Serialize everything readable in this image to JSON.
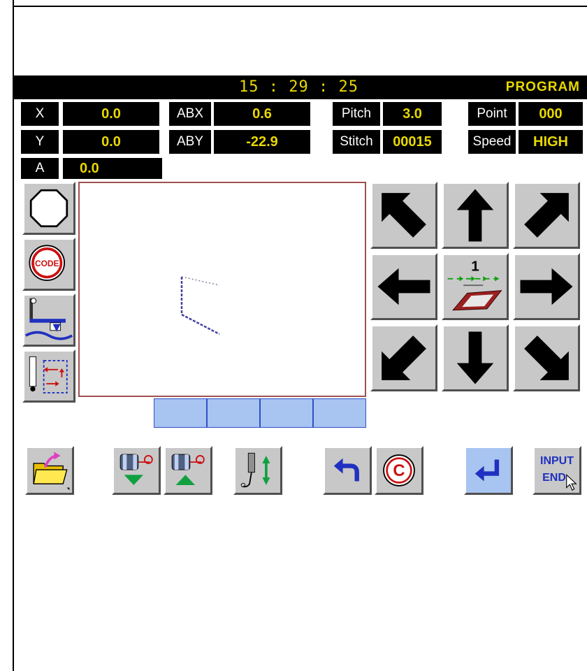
{
  "header": {
    "time": "15 : 29 : 25",
    "mode": "PROGRAM"
  },
  "fields": {
    "x": {
      "label": "X",
      "value": "0.0"
    },
    "y": {
      "label": "Y",
      "value": "0.0"
    },
    "a": {
      "label": "A",
      "value": "0.0"
    },
    "abx": {
      "label": "ABX",
      "value": "0.6"
    },
    "aby": {
      "label": "ABY",
      "value": "-22.9"
    },
    "pitch": {
      "label": "Pitch",
      "value": "3.0"
    },
    "stitch": {
      "label": "Stitch",
      "value": "00015"
    },
    "point": {
      "label": "Point",
      "value": "000"
    },
    "speed": {
      "label": "Speed",
      "value": "HIGH"
    }
  },
  "side_buttons": [
    {
      "icon": "octagon-icon"
    },
    {
      "icon": "code-icon",
      "text": "CODE"
    },
    {
      "icon": "presser-foot-icon"
    },
    {
      "icon": "needle-move-icon"
    }
  ],
  "jog": {
    "center_text": "1",
    "arrows": [
      "up-left",
      "up",
      "up-right",
      "left",
      "right",
      "down-left",
      "down",
      "down-right"
    ]
  },
  "bottom_buttons": [
    {
      "icon": "folder-open-icon"
    },
    {
      "icon": "bobbin-down-icon"
    },
    {
      "icon": "bobbin-up-icon"
    },
    {
      "icon": "needle-up-down-icon"
    },
    {
      "icon": "undo-icon"
    },
    {
      "icon": "clear-icon",
      "text": "C"
    },
    {
      "icon": "enter-icon"
    },
    {
      "icon": "input-end-icon",
      "line1": "INPUT",
      "line2": "END"
    }
  ],
  "colors": {
    "display_bg": "#000000",
    "display_text": "#e8d800",
    "button_face": "#c8c8c8",
    "highlight_blue": "#a8c4f0"
  }
}
